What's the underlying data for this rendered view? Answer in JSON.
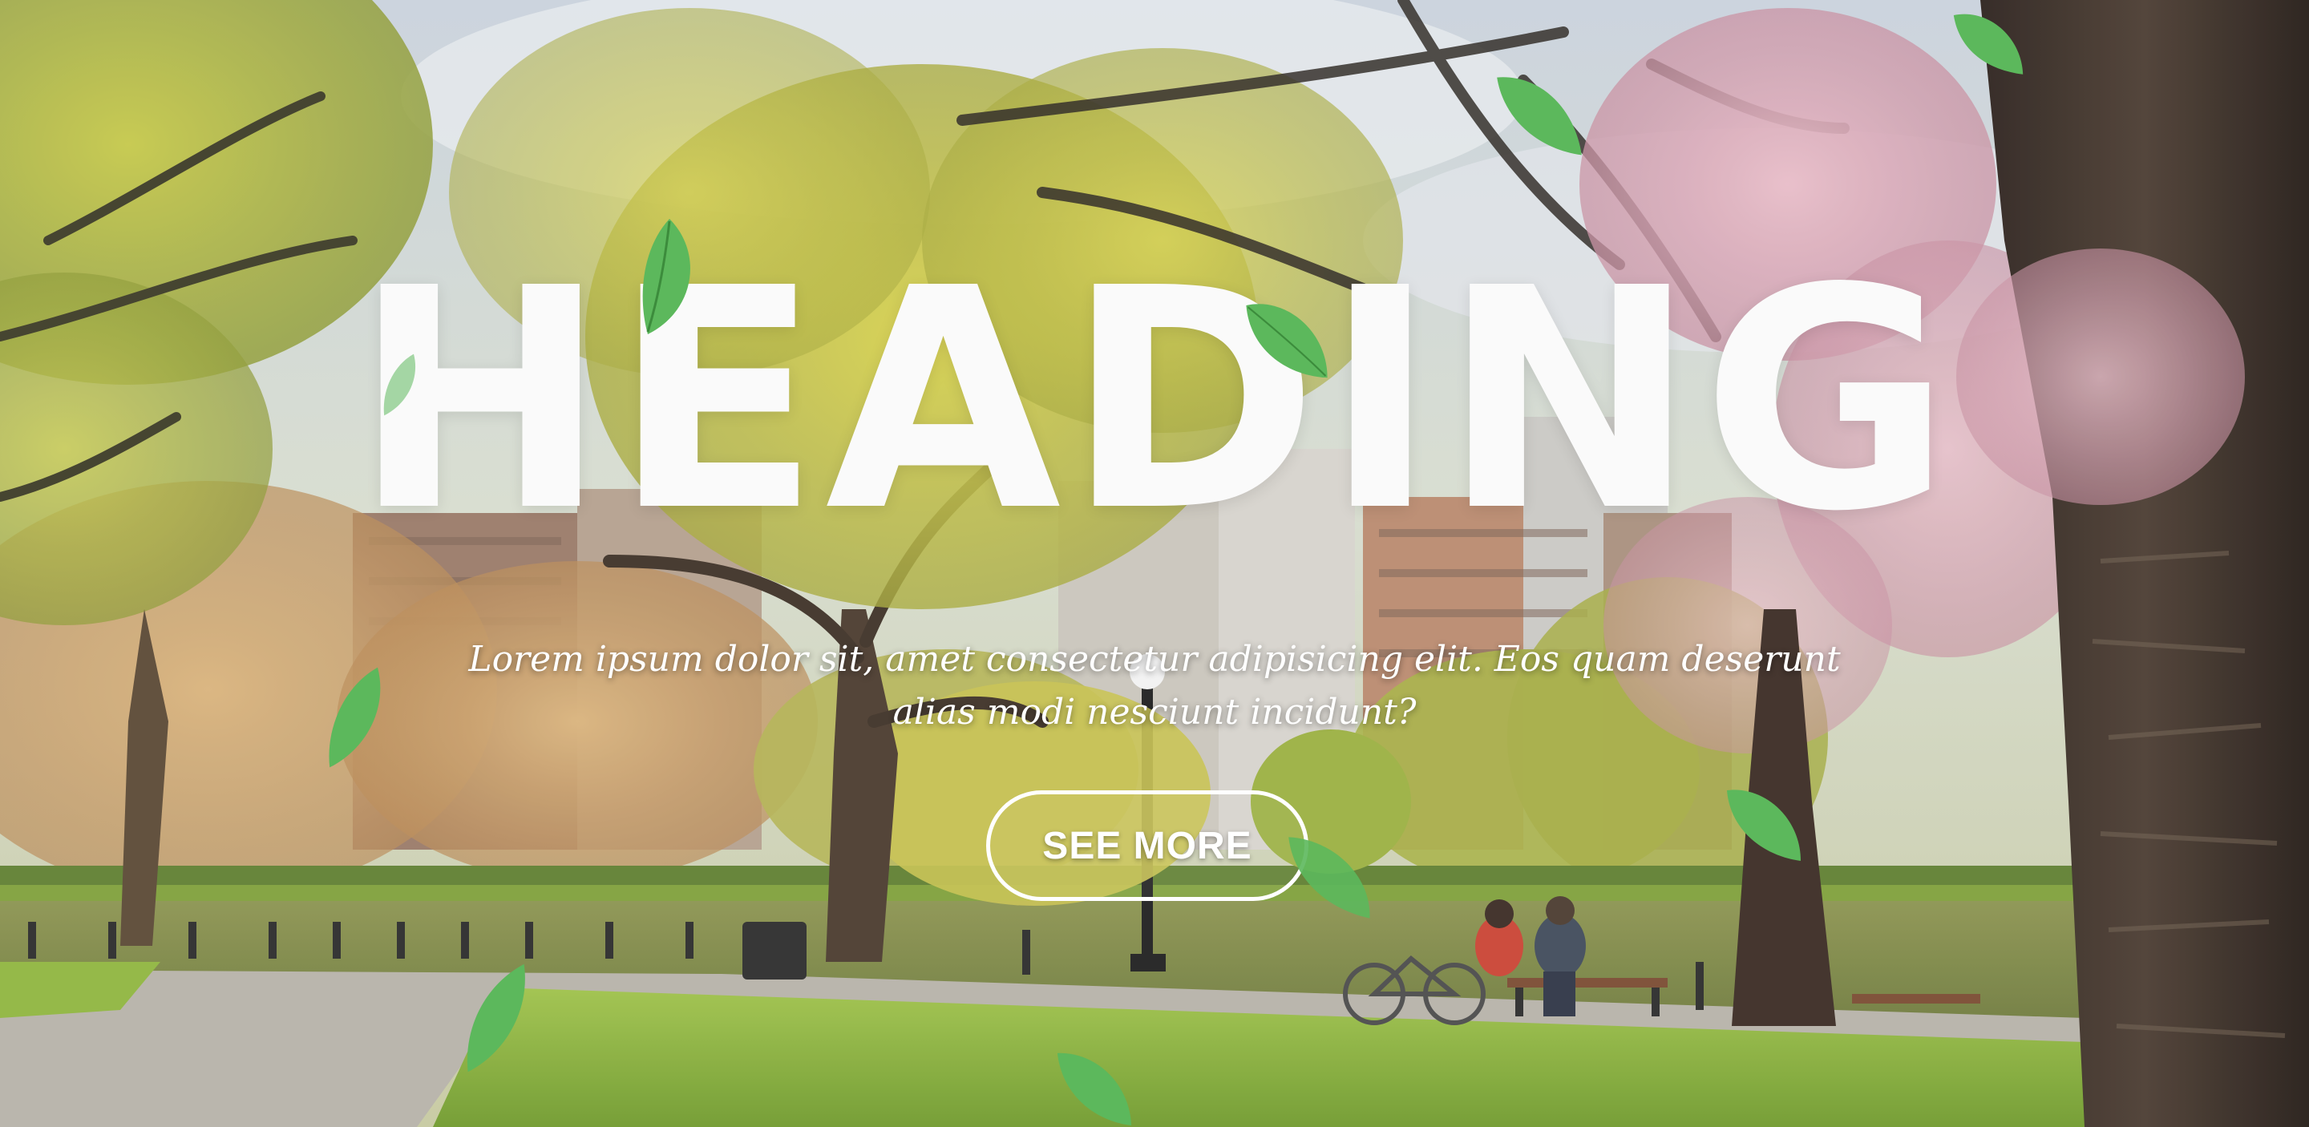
{
  "hero": {
    "heading": "HEADING",
    "subtitle": "Lorem ipsum dolor sit, amet consectetur adipisicing elit. Eos quam deserunt alias modi nesciunt incidunt?",
    "cta_label": "SEE MORE"
  },
  "colors": {
    "heading_text": "#fafafa",
    "body_text": "#ffffff",
    "button_border": "#ffffff",
    "leaf_green": "#5cb85c"
  },
  "decorations": {
    "background": "park-scene-photo",
    "floating_leaves": "leaf-icon"
  }
}
